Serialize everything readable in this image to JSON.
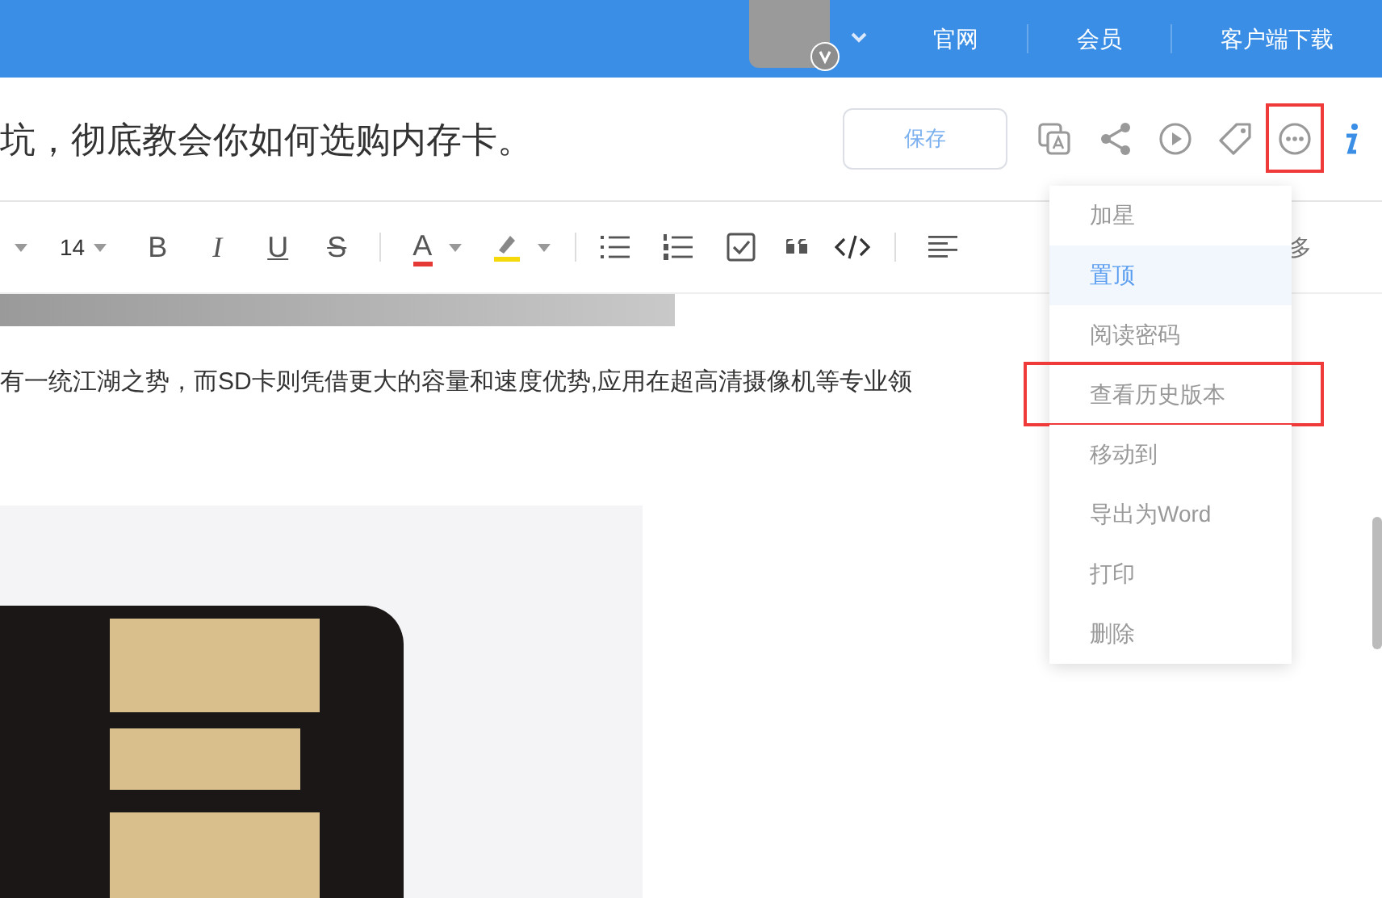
{
  "top_bar": {
    "links": [
      "官网",
      "会员",
      "客户端下载"
    ]
  },
  "note": {
    "title": "坑，彻底教会你如何选购内存卡。",
    "save_button": "保存",
    "more_button_annotated": true
  },
  "toolbar": {
    "font_size": "14",
    "bold": "B",
    "italic": "I",
    "underline": "U",
    "strike": "S",
    "font_color": "A",
    "more": "多"
  },
  "body": {
    "paragraph": "有一统江湖之势，而SD卡则凭借更大的容量和速度优势,应用在超高清摄像机等专业领"
  },
  "menu": {
    "items": [
      {
        "label": "加星",
        "selected": false,
        "annotated": false
      },
      {
        "label": "置顶",
        "selected": true,
        "annotated": false
      },
      {
        "label": "阅读密码",
        "selected": false,
        "annotated": false
      },
      {
        "label": "查看历史版本",
        "selected": false,
        "annotated": true
      },
      {
        "label": "移动到",
        "selected": false,
        "annotated": false
      },
      {
        "label": "导出为Word",
        "selected": false,
        "annotated": false
      },
      {
        "label": "打印",
        "selected": false,
        "annotated": false
      },
      {
        "label": "删除",
        "selected": false,
        "annotated": false
      }
    ]
  }
}
